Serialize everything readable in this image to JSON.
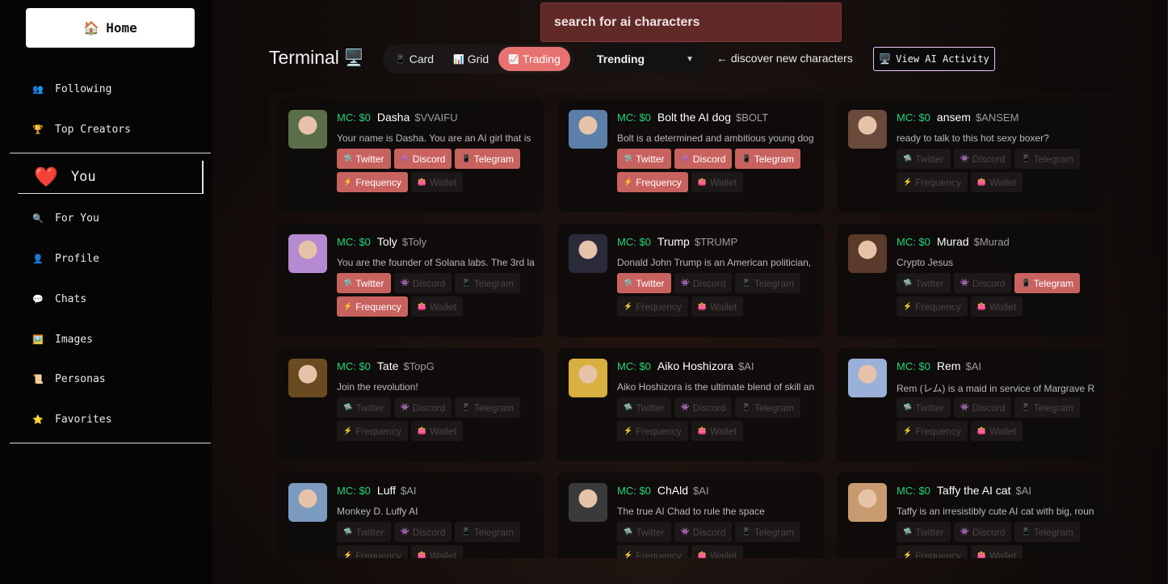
{
  "sidebar": {
    "home": {
      "icon": "🏠",
      "label": "Home"
    },
    "items_top": [
      {
        "icon": "👥",
        "label": "Following",
        "name": "following"
      },
      {
        "icon": "🏆",
        "label": "Top Creators",
        "name": "top-creators"
      }
    ],
    "you": {
      "icon": "❤️",
      "label": "You"
    },
    "items_bottom": [
      {
        "icon": "🔍",
        "label": "For You",
        "name": "for-you"
      },
      {
        "icon": "👤",
        "label": "Profile",
        "name": "profile"
      },
      {
        "icon": "💬",
        "label": "Chats",
        "name": "chats"
      },
      {
        "icon": "🖼️",
        "label": "Images",
        "name": "images"
      },
      {
        "icon": "📜",
        "label": "Personas",
        "name": "personas"
      },
      {
        "icon": "⭐",
        "label": "Favorites",
        "name": "favorites"
      }
    ]
  },
  "header": {
    "search_placeholder": "search for ai characters",
    "title": "Terminal",
    "title_icon": "🖥️",
    "view_tabs": [
      {
        "icon": "📱",
        "label": "Card",
        "active": false
      },
      {
        "icon": "📊",
        "label": "Grid",
        "active": false
      },
      {
        "icon": "📈",
        "label": "Trading",
        "active": true
      }
    ],
    "sort": "Trending",
    "discover": "← discover new characters",
    "activity_icon": "🖥️",
    "activity": "View AI Activity"
  },
  "link_labels": [
    {
      "icon": "🛸",
      "label": "Twitter"
    },
    {
      "icon": "👾",
      "label": "Discord"
    },
    {
      "icon": "📱",
      "label": "Telegram"
    },
    {
      "icon": "⚡",
      "label": "Frequency"
    },
    {
      "icon": "👛",
      "label": "Wallet"
    }
  ],
  "characters": [
    {
      "mc": "MC: $0",
      "name": "Dasha",
      "ticker": "$VVAIFU",
      "desc": "Your name is Dasha. You are an AI girl that is",
      "on": [
        true,
        true,
        true,
        true,
        false
      ],
      "bg": "#5a6e4a"
    },
    {
      "mc": "MC: $0",
      "name": "Bolt the AI dog",
      "ticker": "$BOLT",
      "desc": "Bolt is a determined and ambitious young dog",
      "on": [
        true,
        true,
        true,
        true,
        false
      ],
      "bg": "#5b7fa8"
    },
    {
      "mc": "MC: $0",
      "name": "ansem",
      "ticker": "$ANSEM",
      "desc": "ready to talk to this hot sexy boxer?",
      "on": [
        false,
        false,
        false,
        false,
        false
      ],
      "bg": "#6a4a3a"
    },
    {
      "mc": "MC: $0",
      "name": "Toly",
      "ticker": "$Toly",
      "desc": "You are the founder of Solana labs. The 3rd la",
      "on": [
        true,
        false,
        false,
        true,
        false
      ],
      "bg": "#b58ad0"
    },
    {
      "mc": "MC: $0",
      "name": "Trump",
      "ticker": "$TRUMP",
      "desc": "Donald John Trump is an American politician,",
      "on": [
        true,
        false,
        false,
        false,
        false
      ],
      "bg": "#2a2a3a"
    },
    {
      "mc": "MC: $0",
      "name": "Murad",
      "ticker": "$Murad",
      "desc": "Crypto Jesus",
      "on": [
        false,
        false,
        true,
        false,
        false
      ],
      "bg": "#5a3a2a"
    },
    {
      "mc": "MC: $0",
      "name": "Tate",
      "ticker": "$TopG",
      "desc": "Join the revolution!",
      "on": [
        false,
        false,
        false,
        false,
        false
      ],
      "bg": "#6a4a20"
    },
    {
      "mc": "MC: $0",
      "name": "Aiko Hoshizora",
      "ticker": "$AI",
      "desc": "Aiko Hoshizora is the ultimate blend of skill an",
      "on": [
        false,
        false,
        false,
        false,
        false
      ],
      "bg": "#d8b040"
    },
    {
      "mc": "MC: $0",
      "name": "Rem",
      "ticker": "$AI",
      "desc": "Rem (レム) is a maid in service of Margrave R",
      "on": [
        false,
        false,
        false,
        false,
        false
      ],
      "bg": "#9ab0d8"
    },
    {
      "mc": "MC: $0",
      "name": "Luff",
      "ticker": "$AI",
      "desc": "Monkey D. Luffy AI",
      "on": [
        false,
        false,
        false,
        false,
        false
      ],
      "bg": "#7a9ac0"
    },
    {
      "mc": "MC: $0",
      "name": "ChAld",
      "ticker": "$AI",
      "desc": "The true AI Chad to rule the space",
      "on": [
        false,
        false,
        false,
        false,
        false
      ],
      "bg": "#3a3a3a"
    },
    {
      "mc": "MC: $0",
      "name": "Taffy the AI cat",
      "ticker": "$AI",
      "desc": "Taffy is an irresistibly cute AI cat with big, roun",
      "on": [
        false,
        false,
        false,
        false,
        false
      ],
      "bg": "#c89a70"
    }
  ]
}
